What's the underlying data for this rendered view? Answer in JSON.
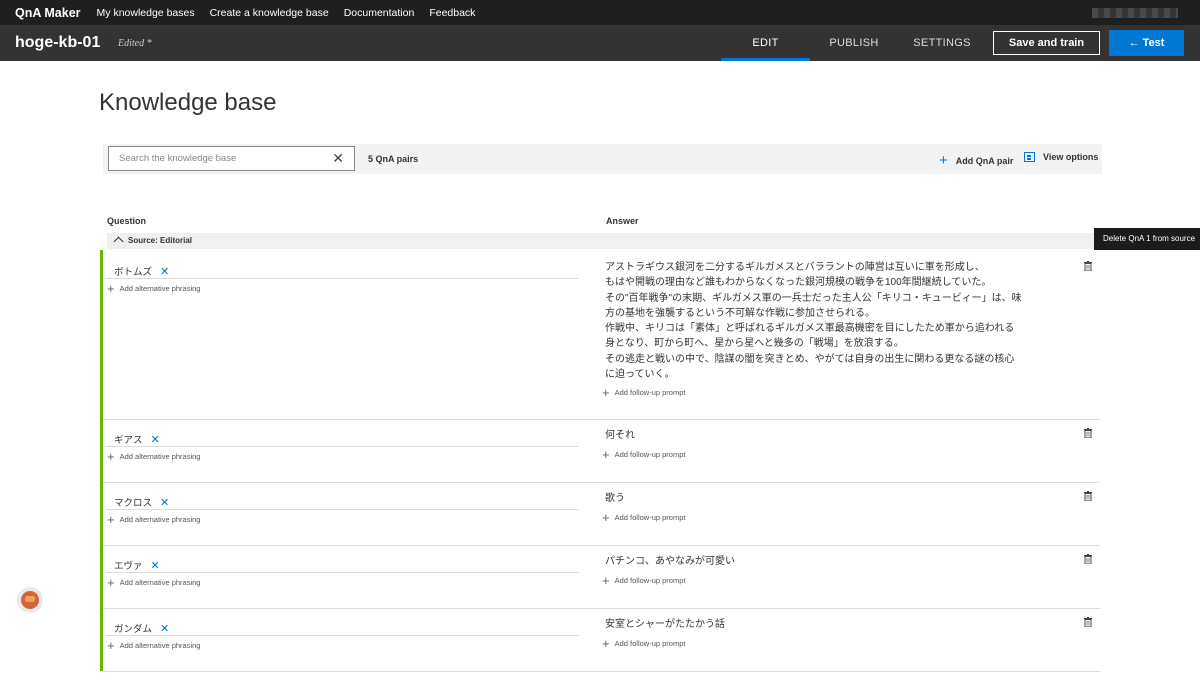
{
  "topnav": {
    "brand": "QnA Maker",
    "links": [
      "My knowledge bases",
      "Create a knowledge base",
      "Documentation",
      "Feedback"
    ]
  },
  "header": {
    "kb_name": "hoge-kb-01",
    "status": "Edited *",
    "tabs": [
      "EDIT",
      "PUBLISH",
      "SETTINGS"
    ],
    "active_tab": "EDIT",
    "save_label": "Save and train",
    "test_label": "← Test"
  },
  "page": {
    "title": "Knowledge base"
  },
  "toolbar": {
    "search_placeholder": "Search the knowledge base",
    "pair_count": "5 QnA pairs",
    "add_pair": "Add QnA pair",
    "view_options": "View options"
  },
  "columns": {
    "question": "Question",
    "answer": "Answer"
  },
  "source": "Source: Editorial",
  "tooltip": "Delete QnA 1 from source",
  "labels": {
    "add_alt": "Add alternative phrasing",
    "add_followup": "Add follow-up prompt"
  },
  "qna": [
    {
      "question": "ボトムズ",
      "answer": [
        "アストラギウス銀河を二分するギルガメスとバララントの陣営は互いに軍を形成し、",
        "もはや開戦の理由など誰もわからなくなった銀河規模の戦争を100年間継続していた。",
        "その\"百年戦争\"の末期、ギルガメス軍の一兵士だった主人公「キリコ・キュービィー」は、味",
        "方の基地を強襲するという不可解な作戦に参加させられる。",
        "作戦中、キリコは「素体」と呼ばれるギルガメス軍最高機密を目にしたため軍から追われる",
        "身となり、町から町へ、星から星へと幾多の「戦場」を放浪する。",
        "その逃走と戦いの中で、陰謀の闇を突きとめ、やがては自身の出生に関わる更なる謎の核心",
        "に迫っていく。"
      ]
    },
    {
      "question": "ギアス",
      "answer": [
        "何それ"
      ]
    },
    {
      "question": "マクロス",
      "answer": [
        "歌う"
      ]
    },
    {
      "question": "エヴァ",
      "answer": [
        "パチンコ、あやなみが可愛い"
      ]
    },
    {
      "question": "ガンダム",
      "answer": [
        "安室とシャーがたたかう話"
      ]
    }
  ],
  "colors": {
    "accent": "#0078d4",
    "source_bar": "#6bb700",
    "header_bg": "#333333",
    "topnav_bg": "#1f1f1f"
  },
  "icons": [
    "close-icon",
    "plus-icon",
    "view-options-icon",
    "chevron-up-icon",
    "trash-icon",
    "avatar-icon"
  ]
}
